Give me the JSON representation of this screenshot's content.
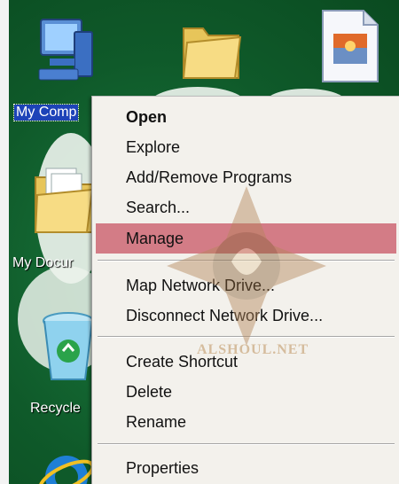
{
  "desktop": {
    "icons": [
      {
        "label": "My Comp",
        "icon": "my-computer-icon"
      },
      {
        "label": "",
        "icon": "folder-icon"
      },
      {
        "label": "",
        "icon": "image-file-icon"
      },
      {
        "label": "My Docur",
        "icon": "my-documents-icon"
      },
      {
        "label": "Recycle",
        "icon": "recycle-bin-icon"
      },
      {
        "label": "",
        "icon": "internet-explorer-icon"
      }
    ]
  },
  "context_menu": {
    "items": [
      {
        "label": "Open",
        "bold": true,
        "highlighted": false
      },
      {
        "label": "Explore",
        "bold": false,
        "highlighted": false
      },
      {
        "label": "Add/Remove Programs",
        "bold": false,
        "highlighted": false
      },
      {
        "label": "Search...",
        "bold": false,
        "highlighted": false
      },
      {
        "label": "Manage",
        "bold": false,
        "highlighted": true
      },
      {
        "label": "Map Network Drive...",
        "bold": false,
        "highlighted": false
      },
      {
        "label": "Disconnect Network Drive...",
        "bold": false,
        "highlighted": false
      },
      {
        "label": "Create Shortcut",
        "bold": false,
        "highlighted": false
      },
      {
        "label": "Delete",
        "bold": false,
        "highlighted": false
      },
      {
        "label": "Rename",
        "bold": false,
        "highlighted": false
      },
      {
        "label": "Properties",
        "bold": false,
        "highlighted": false
      }
    ],
    "highlight_color": "#d37c86"
  },
  "watermark": {
    "text": "ALSHOUL.NET"
  }
}
